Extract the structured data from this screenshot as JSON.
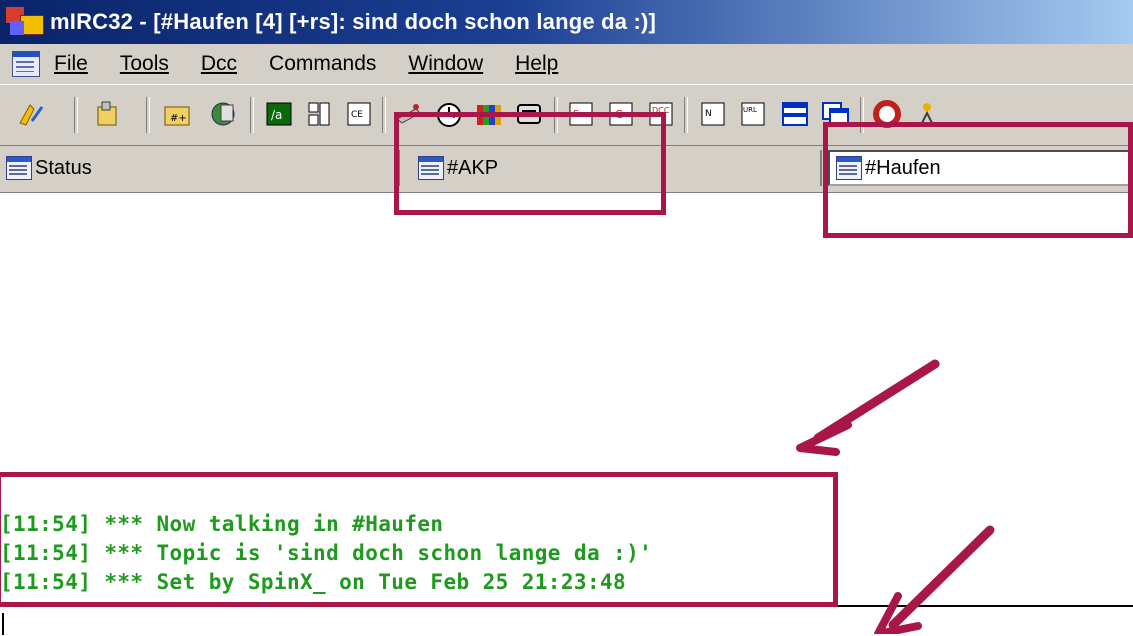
{
  "window": {
    "title": "mIRC32 - [#Haufen [4] [+rs]: sind doch schon lange da :)]"
  },
  "menu": {
    "items": [
      "File",
      "Tools",
      "Dcc",
      "Commands",
      "Window",
      "Help"
    ],
    "underline_first": [
      true,
      true,
      true,
      false,
      true,
      true
    ]
  },
  "toolbar": {
    "buttons": [
      "connect-icon",
      "options-icon",
      "channels-folder-icon",
      "globe-icon",
      "alias-icon",
      "popups-icon",
      "remote-icon",
      "address-book-icon",
      "timer-icon",
      "colors-icon",
      "notify-icon",
      "dcc-send-icon",
      "dcc-chat-icon",
      "dcc-options-icon",
      "notify-list-icon",
      "url-list-icon",
      "tile-icon",
      "cascade-icon",
      "help-icon",
      "about-icon"
    ]
  },
  "switchbar": {
    "tabs": [
      {
        "label": "Status",
        "active": false
      },
      {
        "label": "#AKP",
        "active": false
      },
      {
        "label": "#Haufen",
        "active": true
      }
    ]
  },
  "chat": {
    "lines": [
      "[11:54] *** Now talking in #Haufen",
      "[11:54] *** Topic is 'sind doch schon lange da :)'",
      "[11:54] *** Set by SpinX_ on Tue Feb 25 21:23:48"
    ],
    "text_color": "#1e9a1e"
  },
  "colors": {
    "annotation": "#a8164a",
    "titlebar": "#0a246a",
    "chrome": "#d4d0c8"
  }
}
